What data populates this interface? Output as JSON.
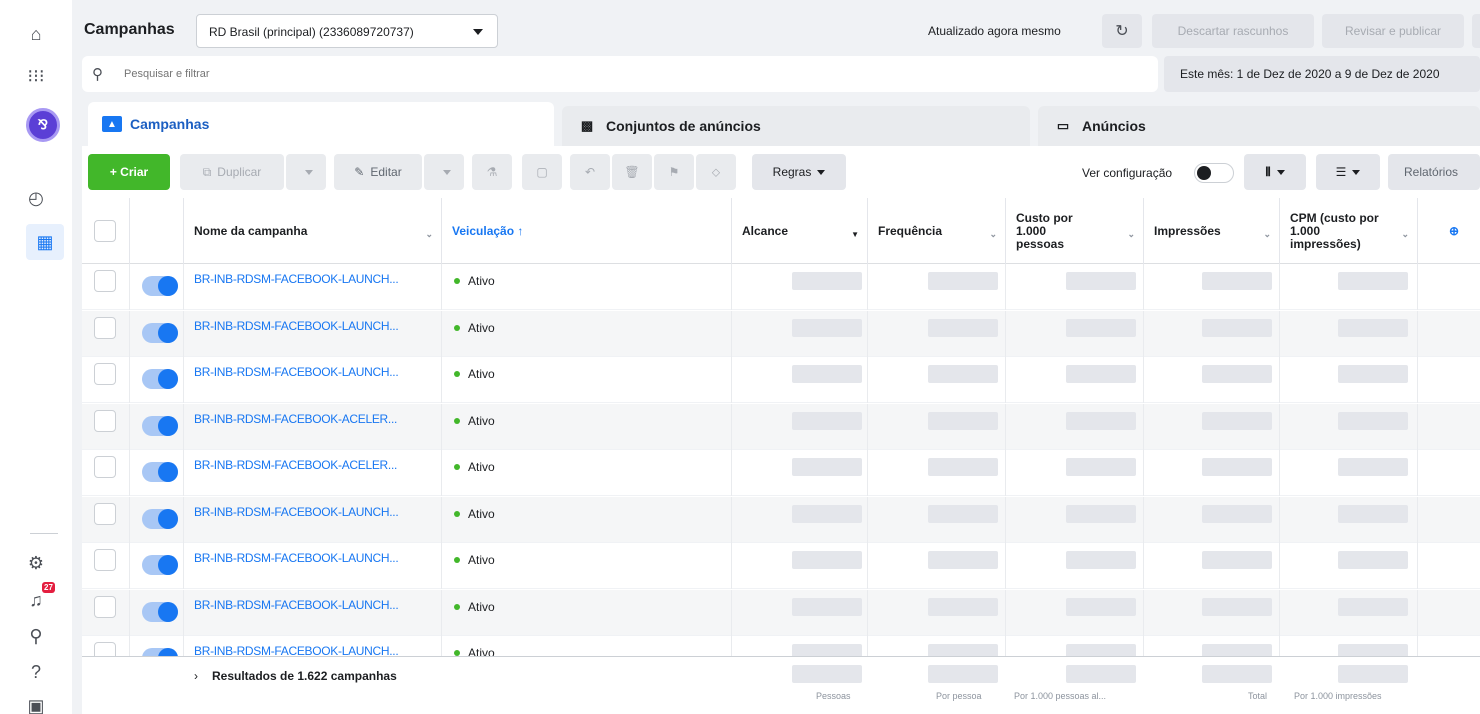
{
  "header": {
    "title": "Campanhas",
    "account": "RD Brasil (principal) (2336089720737)",
    "updated": "Atualizado agora mesmo",
    "discard": "Descartar rascunhos",
    "review": "Revisar e publicar"
  },
  "search": {
    "placeholder": "Pesquisar e filtrar",
    "date_range": "Este mês: 1 de Dez de 2020 a 9 de Dez de 2020"
  },
  "tabs": [
    {
      "label": "Campanhas"
    },
    {
      "label": "Conjuntos de anúncios"
    },
    {
      "label": "Anúncios"
    }
  ],
  "toolbar": {
    "create": "+ Criar",
    "duplicate": "Duplicar",
    "edit": "Editar",
    "rules": "Regras",
    "view_setting": "Ver configuração",
    "reports": "Relatórios"
  },
  "columns": {
    "name": "Nome da campanha",
    "delivery": "Veiculação ↑",
    "reach": "Alcance",
    "frequency": "Frequência",
    "cost_per_1000": "Custo por 1.000 pessoas",
    "impressions": "Impressões",
    "cpm": "CPM (custo por 1.000 impressões)"
  },
  "rows": [
    {
      "name": "BR-INB-RDSM-FACEBOOK-LAUNCH...",
      "status": "Ativo"
    },
    {
      "name": "BR-INB-RDSM-FACEBOOK-LAUNCH...",
      "status": "Ativo"
    },
    {
      "name": "BR-INB-RDSM-FACEBOOK-LAUNCH...",
      "status": "Ativo"
    },
    {
      "name": "BR-INB-RDSM-FACEBOOK-ACELER...",
      "status": "Ativo"
    },
    {
      "name": "BR-INB-RDSM-FACEBOOK-ACELER...",
      "status": "Ativo"
    },
    {
      "name": "BR-INB-RDSM-FACEBOOK-LAUNCH...",
      "status": "Ativo"
    },
    {
      "name": "BR-INB-RDSM-FACEBOOK-LAUNCH...",
      "status": "Ativo"
    },
    {
      "name": "BR-INB-RDSM-FACEBOOK-LAUNCH...",
      "status": "Ativo"
    },
    {
      "name": "BR-INB-RDSM-FACEBOOK-LAUNCH...",
      "status": "Ativo"
    }
  ],
  "footer": {
    "results": "Resultados de 1.622 campanhas",
    "reach_unit": "Pessoas",
    "freq_unit": "Por pessoa",
    "cost_unit": "Por 1.000 pessoas al...",
    "impr_unit": "Total",
    "cpm_unit": "Por 1.000 impressões"
  },
  "rail": {
    "notifications_count": "27"
  },
  "colors": {
    "accent": "#1877f2",
    "create": "#42b72a",
    "status_active": "#42b72a"
  }
}
